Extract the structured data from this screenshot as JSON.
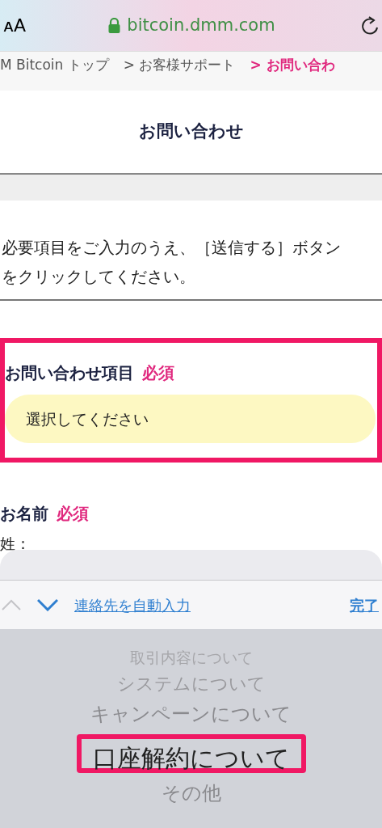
{
  "browser": {
    "text_size": "ᴀA",
    "url": "bitcoin.dmm.com"
  },
  "breadcrumb": [
    {
      "label": "M Bitcoin トップ",
      "current": false
    },
    {
      "label": "> お客様サポート",
      "current": false
    },
    {
      "label": "> お問い合わ",
      "current": true
    }
  ],
  "page_title": "お問い合わせ",
  "intro": "必要項目をご入力のうえ、［送信する］ボタンをクリックしてください。",
  "fields": [
    {
      "label": "お問い合わせ項目",
      "required": "必須",
      "highlighted": true,
      "kind": "select",
      "value": "選択してください"
    },
    {
      "label": "お名前",
      "required": "必須",
      "highlighted": false,
      "kind": "name",
      "sublabel": "姓："
    }
  ],
  "toolbar": {
    "autofill": "連絡先を自動入力",
    "done": "完了"
  },
  "picker": [
    {
      "label": "取引内容について",
      "selected": false
    },
    {
      "label": "システムについて",
      "selected": false
    },
    {
      "label": "キャンペーンについて",
      "selected": false
    },
    {
      "label": "口座解約について",
      "selected": true
    },
    {
      "label": "その他",
      "selected": false
    }
  ]
}
